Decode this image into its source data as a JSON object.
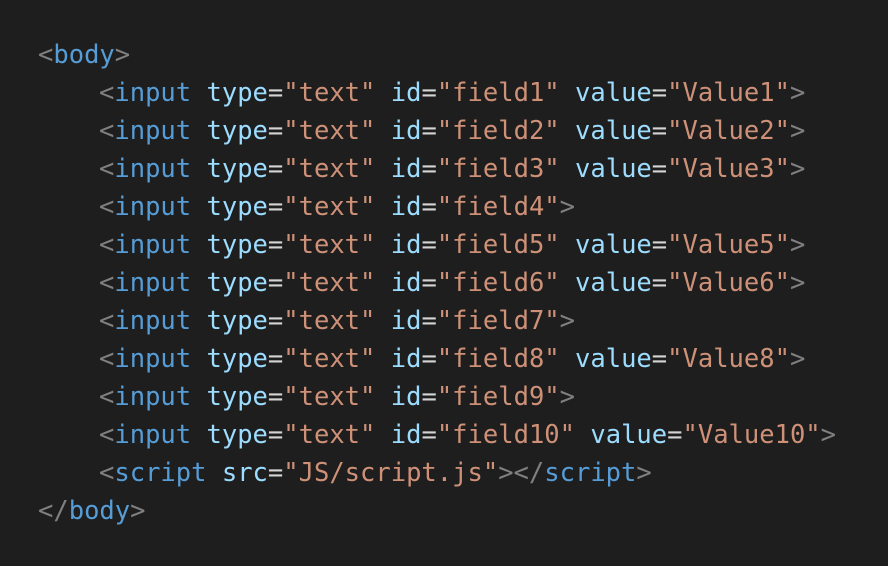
{
  "editor": {
    "colors": {
      "background": "#1e1e1e",
      "punctuation": "#808080",
      "tag": "#569cd6",
      "attribute": "#9cdcfe",
      "equals": "#d4d4d4",
      "string": "#ce9178"
    },
    "body_open_tag": "body",
    "body_close_tag": "body",
    "inputs": [
      {
        "tag": "input",
        "type": "\"text\"",
        "id": "\"field1\"",
        "value": "\"Value1\""
      },
      {
        "tag": "input",
        "type": "\"text\"",
        "id": "\"field2\"",
        "value": "\"Value2\""
      },
      {
        "tag": "input",
        "type": "\"text\"",
        "id": "\"field3\"",
        "value": "\"Value3\""
      },
      {
        "tag": "input",
        "type": "\"text\"",
        "id": "\"field4\""
      },
      {
        "tag": "input",
        "type": "\"text\"",
        "id": "\"field5\"",
        "value": "\"Value5\""
      },
      {
        "tag": "input",
        "type": "\"text\"",
        "id": "\"field6\"",
        "value": "\"Value6\""
      },
      {
        "tag": "input",
        "type": "\"text\"",
        "id": "\"field7\""
      },
      {
        "tag": "input",
        "type": "\"text\"",
        "id": "\"field8\"",
        "value": "\"Value8\""
      },
      {
        "tag": "input",
        "type": "\"text\"",
        "id": "\"field9\""
      },
      {
        "tag": "input",
        "type": "\"text\"",
        "id": "\"field10\"",
        "value": "\"Value10\""
      }
    ],
    "script_line": {
      "tag": "script",
      "src_attr": "src",
      "src_value": "\"JS/script.js\"",
      "close_tag": "script"
    },
    "attr_names": {
      "type": "type",
      "id": "id",
      "value": "value"
    }
  }
}
